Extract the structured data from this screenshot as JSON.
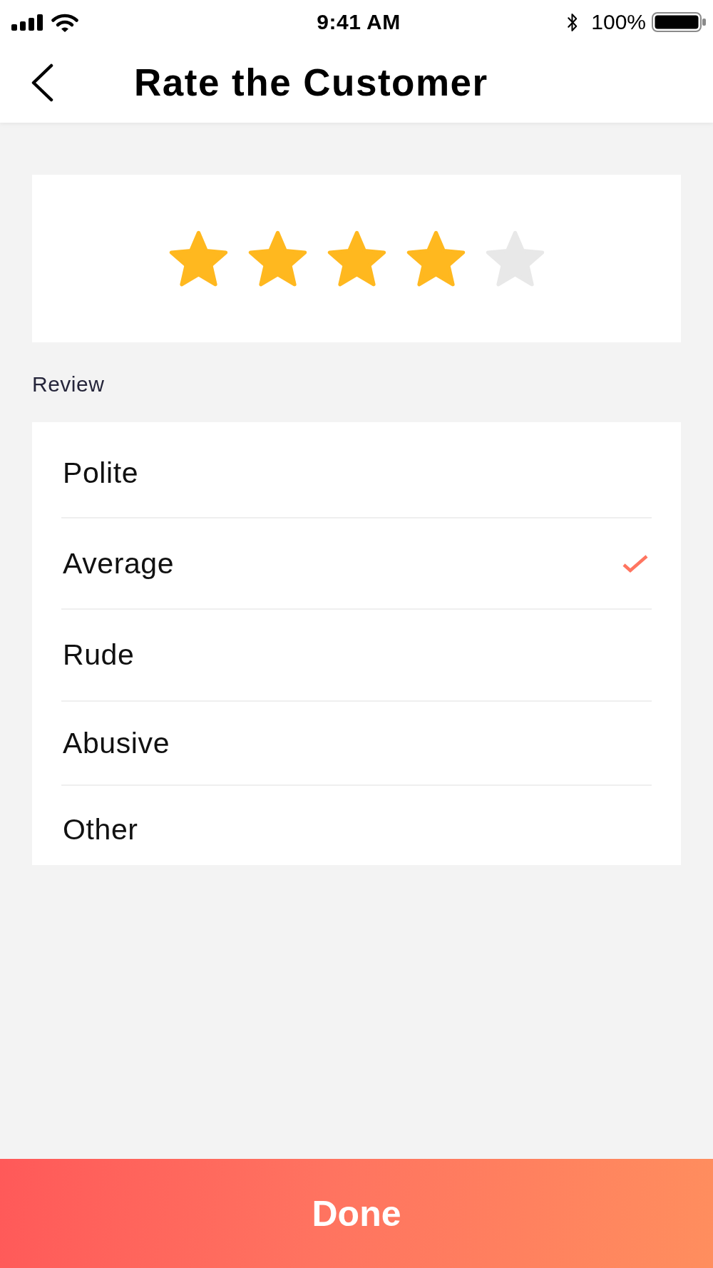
{
  "status_bar": {
    "time": "9:41 AM",
    "battery": "100%"
  },
  "header": {
    "title": "Rate the Customer"
  },
  "rating": {
    "stars": 4
  },
  "review": {
    "label": "Review",
    "options": [
      {
        "label": "Polite",
        "selected": false
      },
      {
        "label": "Average",
        "selected": true
      },
      {
        "label": "Rude",
        "selected": false
      },
      {
        "label": "Abusive",
        "selected": false
      },
      {
        "label": "Other",
        "selected": false
      }
    ]
  },
  "done_button": {
    "label": "Done"
  }
}
